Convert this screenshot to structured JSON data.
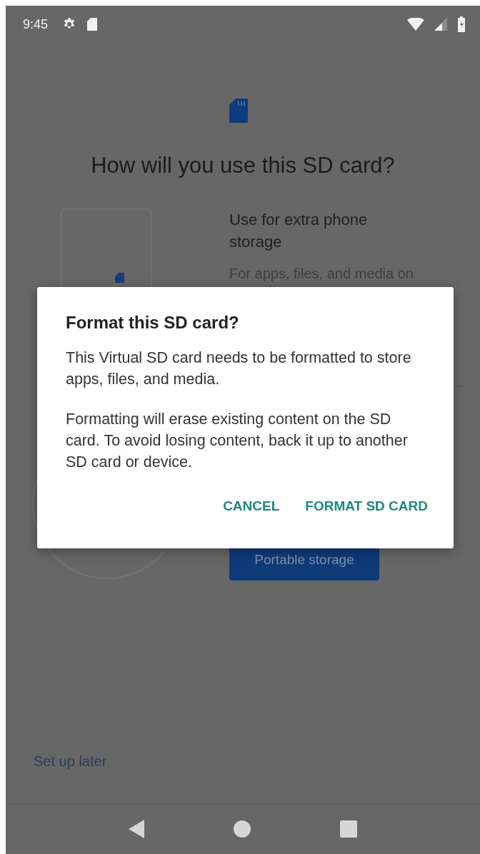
{
  "status_bar": {
    "time": "9:45"
  },
  "setup": {
    "title": "How will you use this SD card?",
    "options": [
      {
        "kind": "internal",
        "heading": "Use for extra phone storage",
        "description": "For apps, files, and media on"
      },
      {
        "kind": "portable",
        "button": "Portable storage"
      }
    ],
    "later_link": "Set up later"
  },
  "dialog": {
    "title": "Format this SD card?",
    "paragraphs": [
      "This Virtual SD card needs to be formatted to store apps, files, and media.",
      "Formatting will erase existing content on the SD card. To avoid losing content, back it up to another SD card or device."
    ],
    "buttons": [
      "CANCEL",
      "FORMAT SD CARD"
    ]
  }
}
